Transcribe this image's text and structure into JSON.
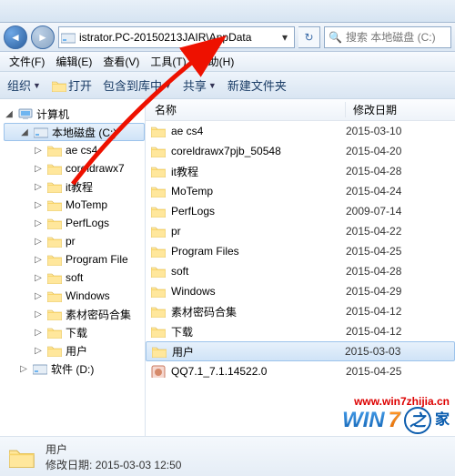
{
  "address": {
    "path": "istrator.PC-20150213JAIR\\AppData"
  },
  "search": {
    "placeholder": "搜索 本地磁盘 (C:)"
  },
  "menu": {
    "file": "文件(F)",
    "edit": "编辑(E)",
    "view": "查看(V)",
    "tools": "工具(T)",
    "help": "帮助(H)"
  },
  "toolbar": {
    "organize": "组织",
    "open": "打开",
    "include": "包含到库中",
    "share": "共享",
    "newfolder": "新建文件夹"
  },
  "columns": {
    "name": "名称",
    "date": "修改日期"
  },
  "tree": {
    "computer": "计算机",
    "c_drive": "本地磁盘 (C:)",
    "d_drive": "软件 (D:)",
    "items": [
      "ae cs4",
      "coreldrawx7",
      "it教程",
      "MoTemp",
      "PerfLogs",
      "pr",
      "Program File",
      "soft",
      "Windows",
      "素材密码合集",
      "下载",
      "用户"
    ]
  },
  "files": [
    {
      "name": "ae cs4",
      "date": "2015-03-10",
      "type": "folder"
    },
    {
      "name": "coreldrawx7pjb_50548",
      "date": "2015-04-20",
      "type": "folder"
    },
    {
      "name": "it教程",
      "date": "2015-04-28",
      "type": "folder"
    },
    {
      "name": "MoTemp",
      "date": "2015-04-24",
      "type": "folder"
    },
    {
      "name": "PerfLogs",
      "date": "2009-07-14",
      "type": "folder"
    },
    {
      "name": "pr",
      "date": "2015-04-22",
      "type": "folder"
    },
    {
      "name": "Program Files",
      "date": "2015-04-25",
      "type": "folder"
    },
    {
      "name": "soft",
      "date": "2015-04-28",
      "type": "folder"
    },
    {
      "name": "Windows",
      "date": "2015-04-29",
      "type": "folder"
    },
    {
      "name": "素材密码合集",
      "date": "2015-04-12",
      "type": "folder"
    },
    {
      "name": "下载",
      "date": "2015-04-12",
      "type": "folder"
    },
    {
      "name": "用户",
      "date": "2015-03-03",
      "type": "folder",
      "selected": true
    },
    {
      "name": "QQ7.1_7.1.14522.0",
      "date": "2015-04-25",
      "type": "exe"
    }
  ],
  "status": {
    "name_label": "用户",
    "date_label": "修改日期:",
    "date_value": "2015-03-03 12:50"
  },
  "watermark": {
    "url": "www.win7zhijia.cn",
    "brand1": "WIN",
    "brand2": "7",
    "brand3": "之",
    "brand4": "家"
  }
}
